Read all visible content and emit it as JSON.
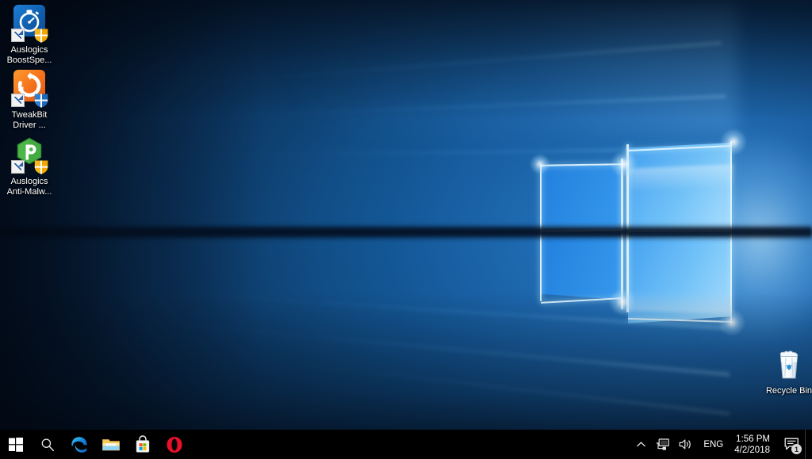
{
  "desktop": {
    "wallpaper_name": "windows-10-hero-wallpaper",
    "colors": {
      "wallpaper_deep": "#04122a",
      "wallpaper_mid": "#0d3764",
      "wallpaper_glow": "#5ab4ff",
      "logo_light": "#afe1ff",
      "taskbar": "#000000",
      "text": "#ffffff"
    },
    "icons": [
      {
        "id": "auslogics-boostspeed",
        "icon_name": "stopwatch-icon",
        "label_line1": "Auslogics",
        "label_line2": "BoostSpe...",
        "tile_color": "#0f5fae",
        "shortcut": true
      },
      {
        "id": "tweakbit-driver-updater",
        "icon_name": "refresh-arrow-icon",
        "label_line1": "TweakBit",
        "label_line2": "Driver ...",
        "tile_color": "#f4701c",
        "shortcut": true
      },
      {
        "id": "auslogics-anti-malware",
        "icon_name": "green-shield-icon",
        "label_line1": "Auslogics",
        "label_line2": "Anti-Malw...",
        "tile_color": "transparent",
        "shortcut": true
      }
    ],
    "recycle_bin": {
      "id": "recycle-bin",
      "icon_name": "recycle-bin-icon",
      "label": "Recycle Bin"
    }
  },
  "taskbar": {
    "start_button": {
      "icon_name": "windows-logo-icon",
      "tooltip": "Start"
    },
    "search_button": {
      "icon_name": "search-icon",
      "tooltip": "Search"
    },
    "pinned": [
      {
        "id": "microsoft-edge",
        "icon_name": "edge-icon",
        "tooltip": "Microsoft Edge"
      },
      {
        "id": "file-explorer",
        "icon_name": "folder-icon",
        "tooltip": "File Explorer"
      },
      {
        "id": "microsoft-store",
        "icon_name": "store-bag-icon",
        "tooltip": "Microsoft Store"
      },
      {
        "id": "opera",
        "icon_name": "opera-icon",
        "tooltip": "Opera"
      }
    ],
    "tray": {
      "overflow": {
        "icon_name": "chevron-up-icon",
        "tooltip": "Show hidden icons"
      },
      "network": {
        "icon_name": "network-monitor-icon",
        "tooltip": "Network"
      },
      "volume": {
        "icon_name": "speaker-icon",
        "tooltip": "Speakers"
      },
      "language": "ENG",
      "clock": {
        "time": "1:56 PM",
        "date": "4/2/2018"
      },
      "action_center": {
        "icon_name": "action-center-icon",
        "badge_count": "1",
        "tooltip": "Notifications"
      },
      "show_desktop": {
        "tooltip": "Show desktop"
      }
    }
  }
}
